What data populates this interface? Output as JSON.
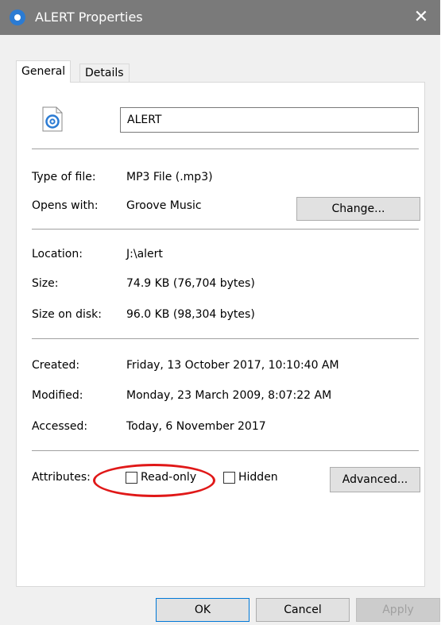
{
  "window": {
    "title": "ALERT Properties",
    "close_glyph": "✕"
  },
  "tabs": [
    {
      "label": "General",
      "active": true
    },
    {
      "label": "Details",
      "active": false
    }
  ],
  "general": {
    "file_icon": "groove-music-file-icon",
    "file_name": "ALERT",
    "type_label": "Type of file:",
    "type_value": "MP3 File (.mp3)",
    "opens_label": "Opens with:",
    "opens_value": "Groove Music",
    "change_button": "Change...",
    "location_label": "Location:",
    "location_value": "J:\\alert",
    "size_label": "Size:",
    "size_value": "74.9 KB (76,704 bytes)",
    "size_disk_label": "Size on disk:",
    "size_disk_value": "96.0 KB (98,304 bytes)",
    "created_label": "Created:",
    "created_value": "Friday, 13 October 2017, 10:10:40 AM",
    "modified_label": "Modified:",
    "modified_value": "Monday, 23 March 2009, 8:07:22 AM",
    "accessed_label": "Accessed:",
    "accessed_value": "Today, 6 November 2017",
    "attributes_label": "Attributes:",
    "readonly_label": "Read-only",
    "readonly_checked": false,
    "hidden_label": "Hidden",
    "hidden_checked": false,
    "advanced_button": "Advanced..."
  },
  "footer": {
    "ok": "OK",
    "cancel": "Cancel",
    "apply": "Apply"
  },
  "colors": {
    "titlebar": "#7a7a7a",
    "accent": "#0078d7",
    "annotation": "#e01818",
    "icon_blue": "#2b7bd3"
  }
}
